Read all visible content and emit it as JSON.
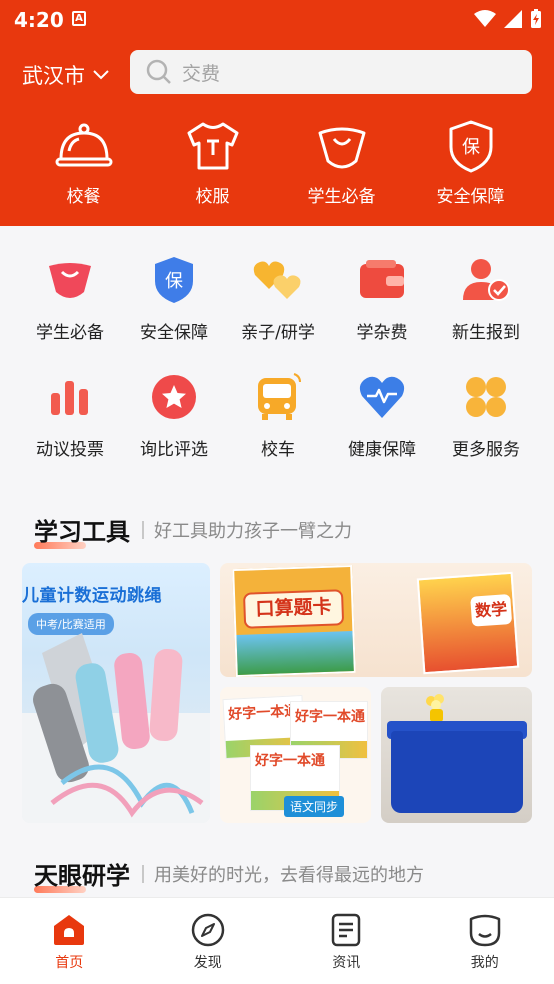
{
  "status": {
    "time": "4:20",
    "badge": "A"
  },
  "header": {
    "city": "武汉市",
    "search_placeholder": "交费",
    "top_nav": [
      {
        "label": "校餐",
        "icon": "cloche-icon"
      },
      {
        "label": "校服",
        "icon": "tshirt-icon"
      },
      {
        "label": "学生必备",
        "icon": "bag-icon"
      },
      {
        "label": "安全保障",
        "icon": "shield-icon"
      }
    ]
  },
  "services": [
    {
      "label": "学生必备",
      "icon": "bag-icon"
    },
    {
      "label": "安全保障",
      "icon": "shield-icon"
    },
    {
      "label": "亲子/研学",
      "icon": "hearts-icon"
    },
    {
      "label": "学杂费",
      "icon": "wallet-icon"
    },
    {
      "label": "新生报到",
      "icon": "user-check-icon"
    },
    {
      "label": "动议投票",
      "icon": "bar-chart-icon"
    },
    {
      "label": "询比评选",
      "icon": "star-icon"
    },
    {
      "label": "校车",
      "icon": "bus-icon"
    },
    {
      "label": "健康保障",
      "icon": "heart-pulse-icon"
    },
    {
      "label": "更多服务",
      "icon": "grid-icon"
    }
  ],
  "tools_section": {
    "title": "学习工具",
    "subtitle": "好工具助力孩子一臂之力",
    "rope_card": {
      "title": "儿童计数运动跳绳",
      "tag": "中考/比赛适用"
    },
    "books_card": {
      "book1_title": "口算题卡",
      "book2_title": "数学"
    },
    "text_card": {
      "book_title": "好字一本通",
      "badge": "语文同步"
    }
  },
  "study_section": {
    "title": "天眼研学",
    "subtitle": "用美好的时光，去看得最远的地方"
  },
  "tabbar": [
    {
      "label": "首页",
      "icon": "home-icon",
      "active": true
    },
    {
      "label": "发现",
      "icon": "compass-icon",
      "active": false
    },
    {
      "label": "资讯",
      "icon": "news-icon",
      "active": false
    },
    {
      "label": "我的",
      "icon": "profile-icon",
      "active": false
    }
  ],
  "colors": {
    "brand": "#e8380e",
    "active_tab": "#e8380e"
  }
}
